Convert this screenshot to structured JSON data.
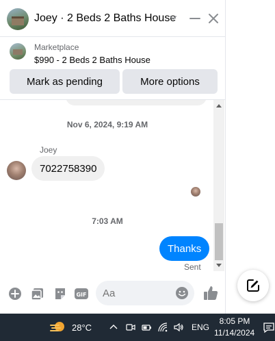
{
  "header": {
    "title": "Joey · 2 Beds 2 Baths House"
  },
  "listing": {
    "label": "Marketplace",
    "price_title": "$990 - 2 Beds 2 Baths House",
    "mark_pending_label": "Mark as pending",
    "more_options_label": "More options"
  },
  "messages": {
    "timestamp_1": "Nov 6, 2024, 9:19 AM",
    "sender_name": "Joey",
    "incoming_text": "7022758390",
    "timestamp_2": "7:03 AM",
    "outgoing_text": "Thanks",
    "status": "Sent"
  },
  "composer": {
    "placeholder": "Aa"
  },
  "taskbar": {
    "temperature": "28°C",
    "language": "ENG",
    "time": "8:05 PM",
    "date": "11/14/2024"
  },
  "colors": {
    "accent": "#0084ff",
    "bubble_in": "#f0f0f0",
    "button_bg": "#e4e6eb",
    "taskbar_bg": "#202a35"
  },
  "icons": [
    "chevron-down-icon",
    "minimize-icon",
    "close-icon",
    "add-circle-icon",
    "photo-icon",
    "sticker-icon",
    "gif-icon",
    "emoji-icon",
    "like-icon",
    "compose-icon",
    "weather-icon",
    "tray-chevron-icon",
    "meet-icon",
    "battery-icon",
    "wifi-icon",
    "volume-icon",
    "notification-icon"
  ]
}
